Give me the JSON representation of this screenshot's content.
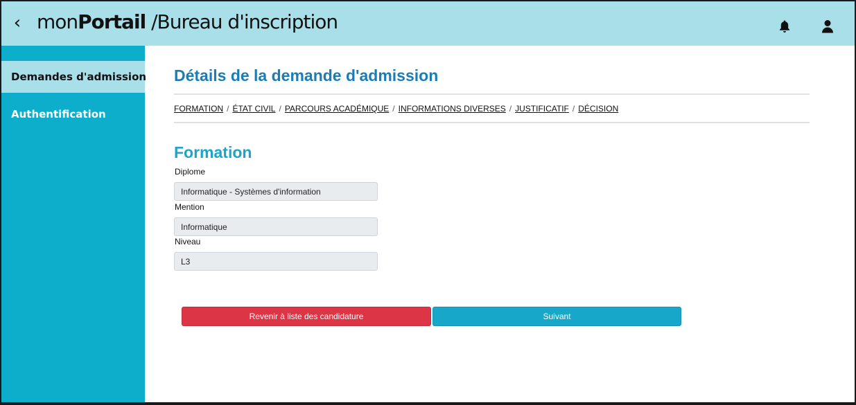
{
  "header": {
    "back_icon": "chevron-left-icon",
    "brand_prefix": "mon",
    "brand_bold": "Portail",
    "brand_suffix": " /Bureau d'inscription",
    "notification_icon": "bell-icon",
    "user_icon": "user-icon"
  },
  "sidebar": {
    "items": [
      {
        "label": "Demandes d'admission",
        "active": true
      },
      {
        "label": "Authentification",
        "active": false
      }
    ]
  },
  "main": {
    "title": "Détails de la demande d'admission",
    "breadcrumb": {
      "items": [
        "FORMATION",
        "ÉTAT CIVIL",
        "PARCOURS ACADÉMIQUE",
        "INFORMATIONS DIVERSES",
        "JUSTIFICATIF",
        "DÉCISION"
      ],
      "separator": "/"
    },
    "section_title": "Formation",
    "fields": [
      {
        "label": "Diplome",
        "value": "Informatique - Systèmes d'information"
      },
      {
        "label": "Mention",
        "value": "Informatique"
      },
      {
        "label": "Niveau",
        "value": "L3"
      }
    ],
    "buttons": {
      "back_label": "Revenir à liste des candidature",
      "next_label": "Suivant"
    }
  },
  "colors": {
    "header_bg": "#a9dfe9",
    "sidebar_bg": "#0daecb",
    "title": "#1a7db5",
    "section_title": "#1aa6cb",
    "danger": "#dc3545",
    "primary": "#17a7c8"
  }
}
